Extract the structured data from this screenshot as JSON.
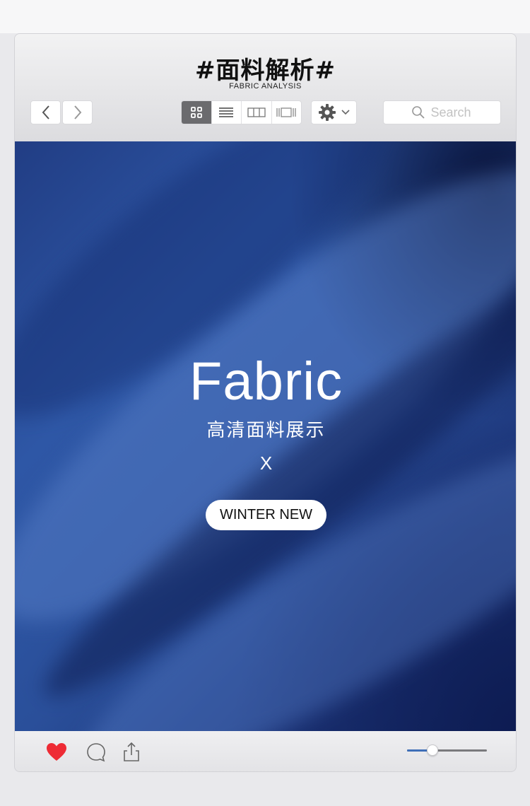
{
  "header": {
    "title": "#面料解析#",
    "subtitle": "FABRIC ANALYSIS"
  },
  "toolbar": {
    "back_icon": "chevron-left-icon",
    "forward_icon": "chevron-right-icon",
    "views": [
      {
        "name": "grid-view",
        "icon": "grid-icon",
        "active": true
      },
      {
        "name": "list-view",
        "icon": "list-icon",
        "active": false
      },
      {
        "name": "column-view",
        "icon": "columns-icon",
        "active": false
      },
      {
        "name": "gallery-view",
        "icon": "gallery-icon",
        "active": false
      }
    ],
    "settings_icon": "gear-icon",
    "search": {
      "placeholder": "Search",
      "value": ""
    }
  },
  "hero": {
    "title": "Fabric",
    "subtitle": "高清面料展示",
    "separator": "X",
    "badge": "WINTER NEW",
    "colors": {
      "fabric_blue": "#2e57a6",
      "deep_navy": "#162a66"
    }
  },
  "footer": {
    "like_icon": "heart-icon",
    "like_color": "#ee2b35",
    "comment_icon": "comment-icon",
    "share_icon": "share-icon",
    "slider": {
      "value": 0.32,
      "fill_color": "#3f6fb8"
    }
  }
}
